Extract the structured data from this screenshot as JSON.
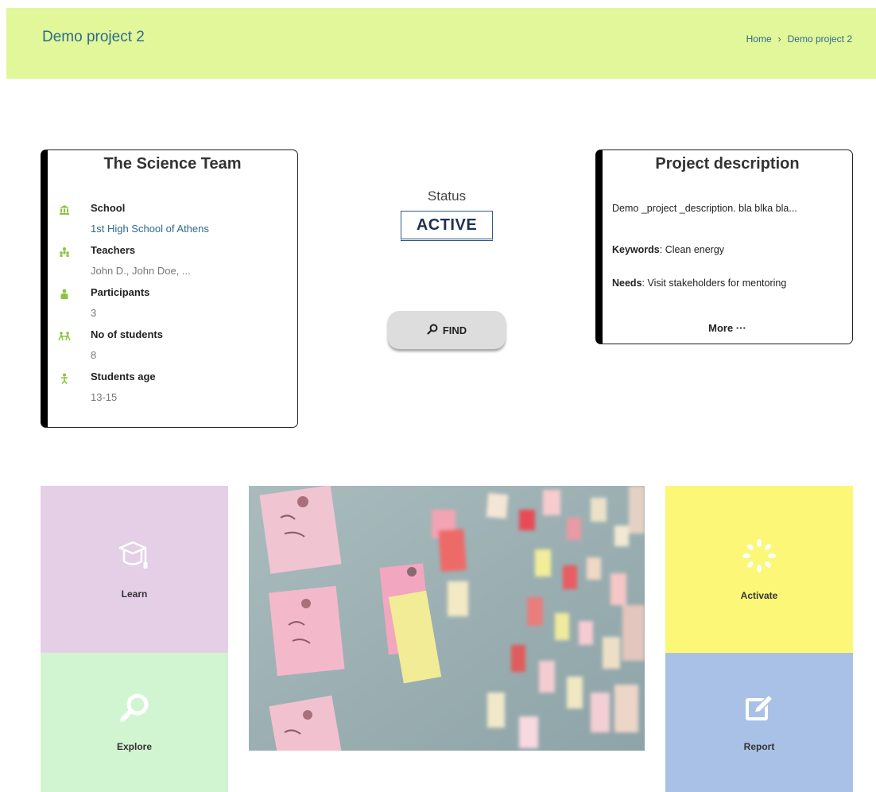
{
  "header": {
    "title": "Demo project 2",
    "breadcrumb": {
      "home": "Home",
      "separator": "›",
      "current": "Demo project 2"
    }
  },
  "team_card": {
    "title": "The Science Team",
    "items": [
      {
        "icon": "institution-icon",
        "label": "School",
        "value": "1st High School of Athens"
      },
      {
        "icon": "teachers-icon",
        "label": "Teachers",
        "value": "John D., John Doe, ..."
      },
      {
        "icon": "participant-icon",
        "label": "Participants",
        "value": "3"
      },
      {
        "icon": "students-icon",
        "label": "No of students",
        "value": "8"
      },
      {
        "icon": "age-icon",
        "label": "Students age",
        "value": "13-15"
      }
    ]
  },
  "status": {
    "label": "Status",
    "value": "ACTIVE"
  },
  "find_button": {
    "label": "FIND",
    "icon": "search-icon"
  },
  "description_card": {
    "title": "Project description",
    "description": "Demo _project _description. bla blka bla...",
    "keywords_label": "Keywords",
    "keywords_value": ": Clean energy",
    "needs_label": "Needs",
    "needs_value": ": Visit stakeholders for mentoring",
    "more": "More ···"
  },
  "tiles": {
    "learn": {
      "label": "Learn",
      "icon": "graduation-cap-icon"
    },
    "explore": {
      "label": "Explore",
      "icon": "magnifier-icon"
    },
    "activate": {
      "label": "Activate",
      "icon": "spinner-icon"
    },
    "report": {
      "label": "Report",
      "icon": "edit-icon"
    }
  },
  "colors": {
    "header_bg": "#e1f799",
    "accent_text": "#2d6b8c",
    "icon_green": "#8ac43f",
    "learn_bg": "#e4cfe7",
    "explore_bg": "#d1f5d1",
    "activate_bg": "#fdf777",
    "report_bg": "#a9c1e6"
  }
}
